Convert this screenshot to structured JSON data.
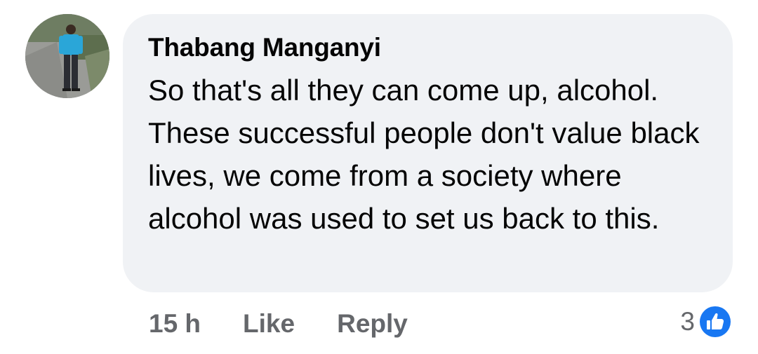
{
  "comment": {
    "author": "Thabang Manganyi",
    "text": "So that's all they can come up, alcohol. These successful people don't value black lives, we come from a society where alcohol was used to set us back to this.",
    "timestamp": "15 h",
    "like_label": "Like",
    "reply_label": "Reply",
    "reaction_count": "3",
    "reaction_icon": "thumbs-up-icon",
    "colors": {
      "bubble": "#f0f2f5",
      "text": "#050505",
      "secondary_text": "#65676b",
      "like_blue": "#1877f2"
    }
  }
}
